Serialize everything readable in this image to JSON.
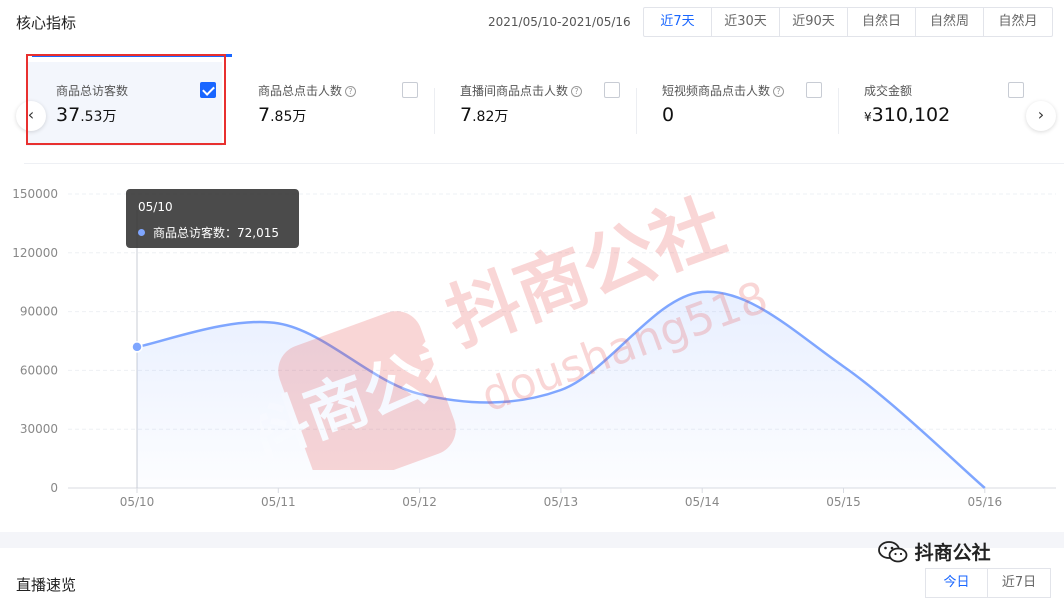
{
  "header": {
    "title": "核心指标",
    "date_range": "2021/05/10-2021/05/16",
    "range_tabs": [
      {
        "label": "近7天",
        "active": true
      },
      {
        "label": "近30天",
        "active": false
      },
      {
        "label": "近90天",
        "active": false
      },
      {
        "label": "自然日",
        "active": false
      },
      {
        "label": "自然周",
        "active": false
      },
      {
        "label": "自然月",
        "active": false
      }
    ]
  },
  "metrics": [
    {
      "label": "商品总访客数",
      "value_main": "37",
      "value_small": ".53万",
      "help": false,
      "checked": true
    },
    {
      "label": "商品总点击人数",
      "value_main": "7",
      "value_small": ".85万",
      "help": true,
      "checked": false
    },
    {
      "label": "直播间商品点击人数",
      "value_main": "7",
      "value_small": ".82万",
      "help": true,
      "checked": false
    },
    {
      "label": "短视频商品点击人数",
      "value_main": "0",
      "value_small": "",
      "help": true,
      "checked": false
    },
    {
      "label": "成交金额",
      "currency": "¥",
      "value_main": "310,102",
      "value_small": "",
      "help": false,
      "checked": false
    }
  ],
  "icons": {
    "help": "?",
    "nav_prev": "‹",
    "nav_next": "›",
    "wechat": "wechat-icon"
  },
  "tooltip": {
    "date": "05/10",
    "series_label": "商品总访客数",
    "separator": "：",
    "value": "72,015"
  },
  "chart_data": {
    "type": "area",
    "x": [
      "05/10",
      "05/11",
      "05/12",
      "05/13",
      "05/14",
      "05/15",
      "05/16"
    ],
    "series": [
      {
        "name": "商品总访客数",
        "values": [
          72015,
          84000,
          48000,
          50000,
          100000,
          62000,
          0
        ]
      }
    ],
    "ylim": [
      0,
      150000
    ],
    "yticks": [
      0,
      30000,
      60000,
      90000,
      120000,
      150000
    ],
    "grid": true,
    "line_color": "#7fa6ff"
  },
  "watermark": {
    "brand": "抖商公社",
    "url_text": "doushang518",
    "logo_text": "抖商公社"
  },
  "footer": {
    "section_title": "直播速览",
    "tabs": [
      {
        "label": "今日",
        "active": true
      },
      {
        "label": "近7日",
        "active": false
      }
    ],
    "wechat_account": "抖商公社"
  },
  "colors": {
    "accent": "#1966ff",
    "highlight": "#e8302f",
    "watermark": "#e84a4a"
  }
}
